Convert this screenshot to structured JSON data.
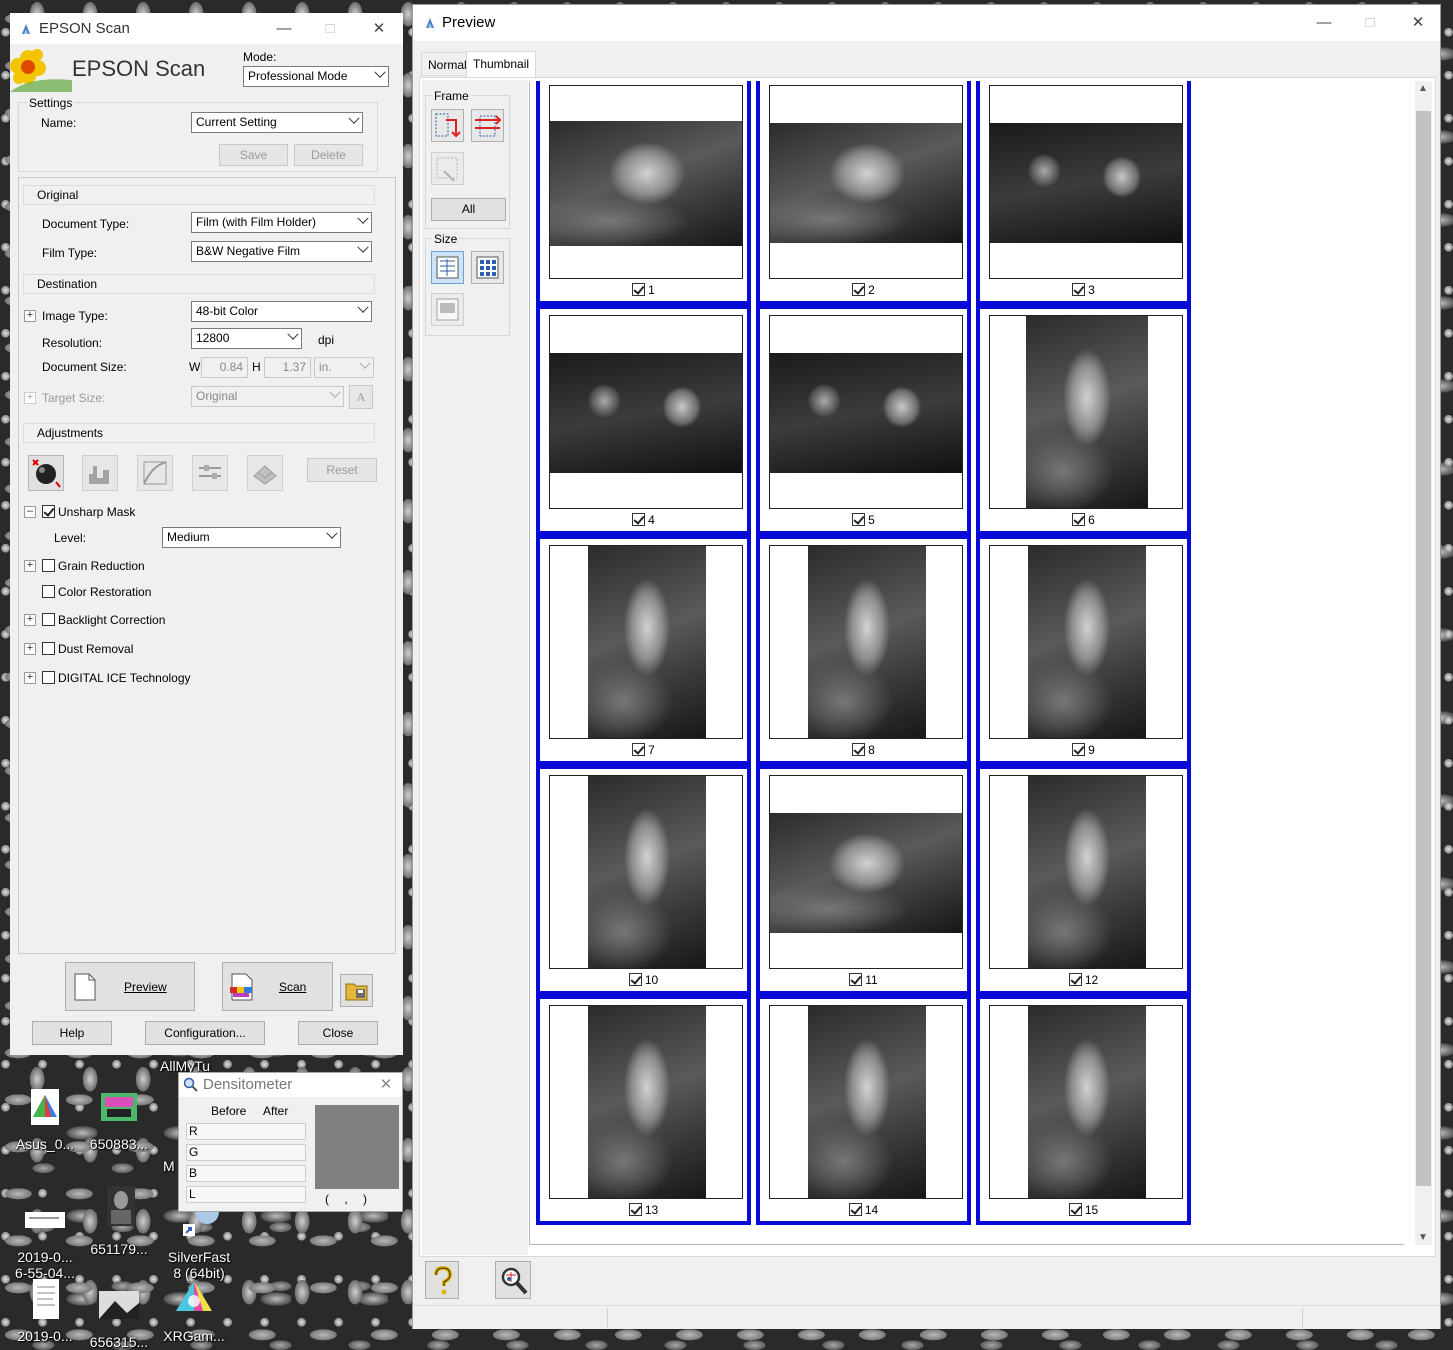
{
  "scan_window": {
    "title": "EPSON Scan",
    "brand": "EPSON Scan",
    "mode_label": "Mode:",
    "mode_value": "Professional Mode",
    "settings": {
      "group_label": "Settings",
      "name_label": "Name:",
      "name_value": "Current Setting",
      "save_label": "Save",
      "delete_label": "Delete"
    },
    "original": {
      "header": "Original",
      "document_type_label": "Document Type:",
      "document_type_value": "Film (with Film Holder)",
      "film_type_label": "Film Type:",
      "film_type_value": "B&W Negative Film"
    },
    "destination": {
      "header": "Destination",
      "image_type_label": "Image Type:",
      "image_type_value": "48-bit Color",
      "resolution_label": "Resolution:",
      "resolution_value": "12800",
      "resolution_unit": "dpi",
      "document_size_label": "Document Size:",
      "w_label": "W",
      "w_value": "0.84",
      "h_label": "H",
      "h_value": "1.37",
      "size_unit": "in.",
      "target_size_label": "Target Size:",
      "target_size_value": "Original"
    },
    "adjustments": {
      "header": "Adjustments",
      "reset_label": "Reset",
      "unsharp_mask_label": "Unsharp Mask",
      "level_label": "Level:",
      "level_value": "Medium",
      "grain_reduction_label": "Grain Reduction",
      "color_restoration_label": "Color Restoration",
      "backlight_correction_label": "Backlight Correction",
      "dust_removal_label": "Dust Removal",
      "digital_ice_label": "DIGITAL ICE Technology"
    },
    "preview_label": "Preview",
    "scan_label": "Scan",
    "help_label": "Help",
    "configuration_label": "Configuration...",
    "close_label": "Close"
  },
  "preview_window": {
    "title": "Preview",
    "tabs": [
      "Normal",
      "Thumbnail"
    ],
    "active_tab": "Thumbnail",
    "frame_group_label": "Frame",
    "all_label": "All",
    "size_group_label": "Size",
    "thumbnails": [
      {
        "label": "1",
        "checked": true
      },
      {
        "label": "2",
        "checked": true
      },
      {
        "label": "3",
        "checked": true
      },
      {
        "label": "4",
        "checked": true
      },
      {
        "label": "5",
        "checked": true
      },
      {
        "label": "6",
        "checked": true
      },
      {
        "label": "7",
        "checked": true
      },
      {
        "label": "8",
        "checked": true
      },
      {
        "label": "9",
        "checked": true
      },
      {
        "label": "10",
        "checked": true
      },
      {
        "label": "11",
        "checked": true
      },
      {
        "label": "12",
        "checked": true
      },
      {
        "label": "13",
        "checked": true
      },
      {
        "label": "14",
        "checked": true
      },
      {
        "label": "15",
        "checked": true
      }
    ]
  },
  "densitometer": {
    "title": "Densitometer",
    "before_label": "Before",
    "after_label": "After",
    "rows": [
      "R",
      "G",
      "B",
      "L"
    ],
    "swatch_caption": "(    ,    )"
  },
  "desktop_icons": [
    {
      "label": "Asus_0..."
    },
    {
      "label": "650883..."
    },
    {
      "label": "2019-0...\n6-55-04..."
    },
    {
      "label": "651179..."
    },
    {
      "label": "SilverFast\n8 (64bit)"
    },
    {
      "label": "2019-0..."
    },
    {
      "label": "656315..."
    },
    {
      "label": "XRGam..."
    }
  ],
  "desktop_text": [
    "AllMyTu",
    "M"
  ]
}
